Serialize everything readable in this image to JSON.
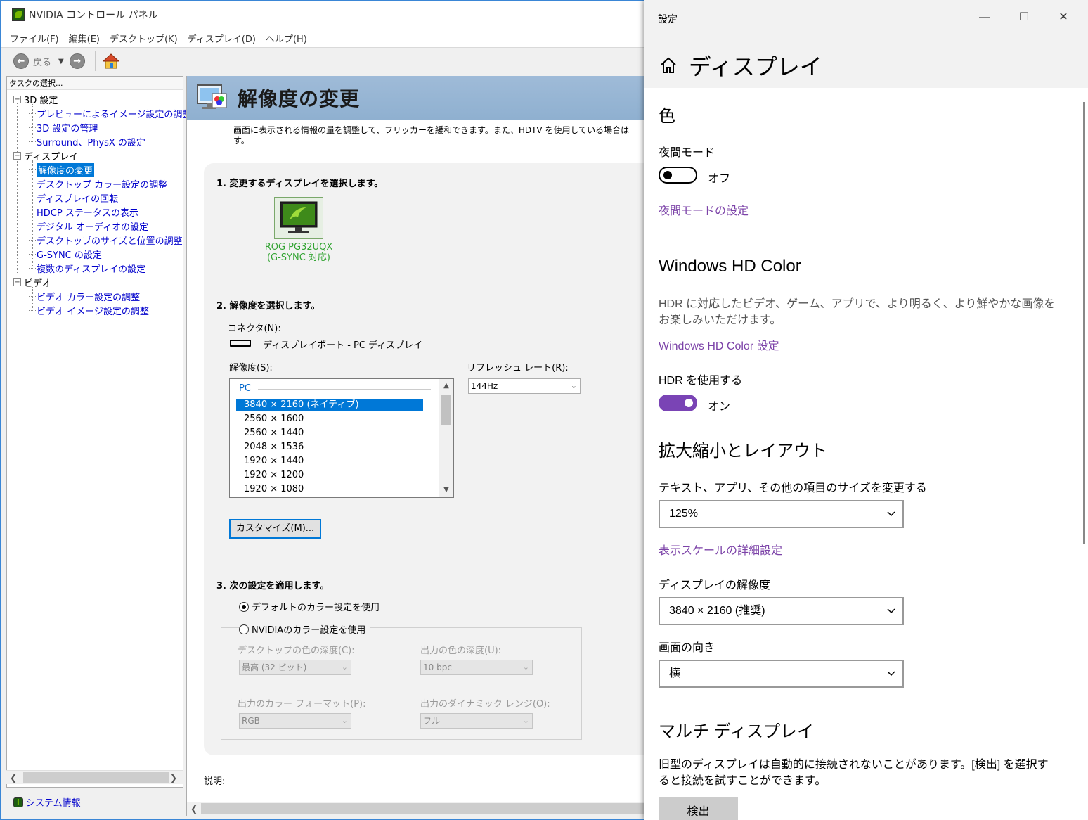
{
  "nvidia": {
    "title": "NVIDIA コントロール パネル",
    "menu": [
      "ファイル(F)",
      "編集(E)",
      "デスクトップ(K)",
      "ディスプレイ(D)",
      "ヘルプ(H)"
    ],
    "toolbar": {
      "back_label": "戻る"
    },
    "sidebar": {
      "header": "タスクの選択...",
      "categories": [
        {
          "label": "3D 設定",
          "items": [
            "プレビューによるイメージ設定の調整",
            "3D 設定の管理",
            "Surround、PhysX の設定"
          ]
        },
        {
          "label": "ディスプレイ",
          "items": [
            "解像度の変更",
            "デスクトップ カラー設定の調整",
            "ディスプレイの回転",
            "HDCP ステータスの表示",
            "デジタル オーディオの設定",
            "デスクトップのサイズと位置の調整",
            "G-SYNC の設定",
            "複数のディスプレイの設定"
          ]
        },
        {
          "label": "ビデオ",
          "items": [
            "ビデオ カラー設定の調整",
            "ビデオ イメージ設定の調整"
          ]
        }
      ],
      "selected_item": "解像度の変更",
      "system_info": "システム情報"
    },
    "page": {
      "title": "解像度の変更",
      "description": "画面に表示される情報の量を調整して、フリッカーを緩和できます。また、HDTV を使用している場合は",
      "description_line2": "す。",
      "step1": "1. 変更するディスプレイを選択します。",
      "display_name_line1": "ROG PG32UQX",
      "display_name_line2": "(G-SYNC 対応)",
      "step2": "2. 解像度を選択します。",
      "connector_label": "コネクタ(N):",
      "connector_value": "ディスプレイポート - PC ディスプレイ",
      "resolution_label": "解像度(S):",
      "resolution_group": "PC",
      "resolutions": [
        "3840 × 2160 (ネイティブ)",
        "2560 × 1600",
        "2560 × 1440",
        "2048 × 1536",
        "1920 × 1440",
        "1920 × 1200",
        "1920 × 1080"
      ],
      "selected_resolution": "3840 × 2160 (ネイティブ)",
      "refresh_label": "リフレッシュ レート(R):",
      "refresh_value": "144Hz",
      "customize_button": "カスタマイズ(M)...",
      "step3": "3. 次の設定を適用します。",
      "radio_default": "デフォルトのカラー設定を使用",
      "radio_nvidia": "NVIDIAのカラー設定を使用",
      "radio_selected": "default",
      "desktop_color_depth_label": "デスクトップの色の深度(C):",
      "desktop_color_depth_value": "最高 (32 ビット)",
      "output_color_depth_label": "出力の色の深度(U):",
      "output_color_depth_value": "10 bpc",
      "output_color_format_label": "出力のカラー フォーマット(P):",
      "output_color_format_value": "RGB",
      "output_dynamic_range_label": "出力のダイナミック レンジ(O):",
      "output_dynamic_range_value": "フル",
      "explanation_label": "説明:"
    }
  },
  "settings": {
    "title": "設定",
    "header": "ディスプレイ",
    "color_section": "色",
    "night_mode_label": "夜間モード",
    "night_mode_state": "オフ",
    "night_mode_link": "夜間モードの設定",
    "hd_color_section": "Windows HD Color",
    "hd_color_description": "HDR に対応したビデオ、ゲーム、アプリで、より明るく、より鮮やかな画像をお楽しみいただけます。",
    "hd_color_link": "Windows HD Color 設定",
    "hdr_label": "HDR を使用する",
    "hdr_state": "オン",
    "scale_section": "拡大縮小とレイアウト",
    "scale_label": "テキスト、アプリ、その他の項目のサイズを変更する",
    "scale_value": "125%",
    "scale_link": "表示スケールの詳細設定",
    "resolution_label": "ディスプレイの解像度",
    "resolution_value": "3840 × 2160 (推奨)",
    "orientation_label": "画面の向き",
    "orientation_value": "横",
    "multi_section": "マルチ ディスプレイ",
    "multi_description": "旧型のディスプレイは自動的に接続されないことがあります。[検出] を選択すると接続を試すことができます。",
    "detect_button": "検出"
  },
  "colors": {
    "accent_purple": "#7a44b5",
    "link_purple": "#7c43a8",
    "nvidia_green": "#76b900",
    "selection_blue": "#0078d7"
  }
}
